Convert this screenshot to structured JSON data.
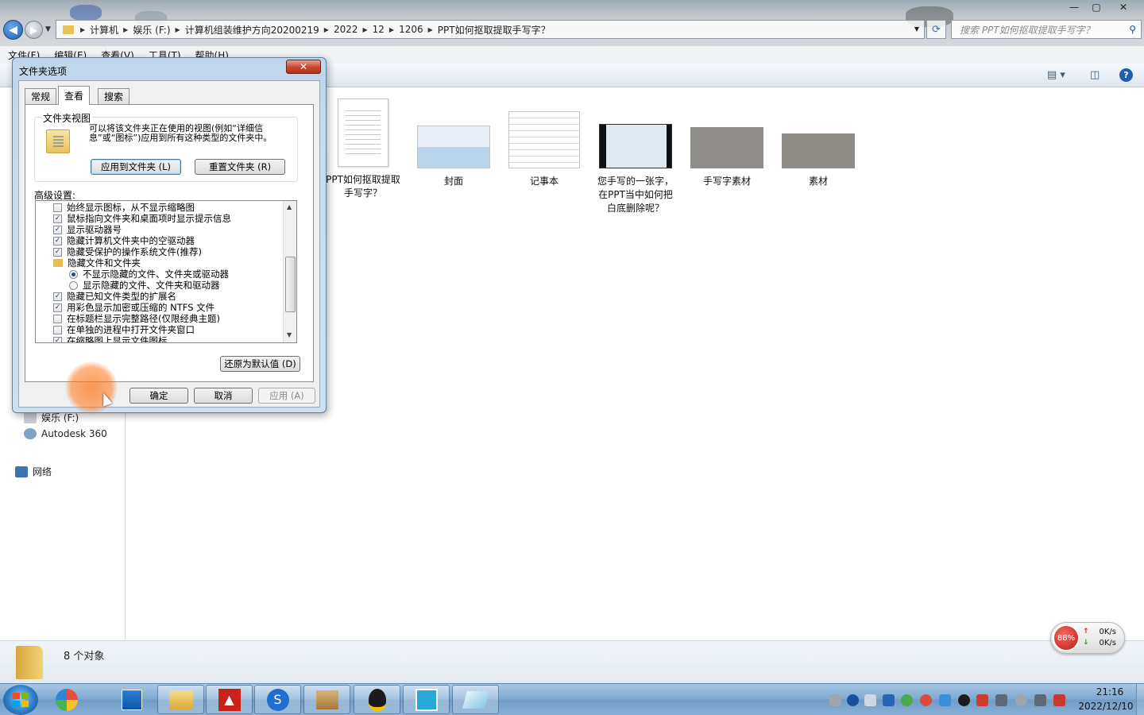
{
  "window": {
    "controls": [
      "—",
      "▢",
      "✕"
    ],
    "breadcrumb": [
      "计算机",
      "娱乐 (F:)",
      "计算机组装维护方向20200219",
      "2022",
      "12",
      "1206",
      "PPT如何抠取提取手写字？"
    ],
    "search_placeholder": "搜索 PPT如何抠取提取手写字？"
  },
  "menu": [
    "文件(F)",
    "编辑(E)",
    "查看(V)",
    "工具(T)",
    "帮助(H)"
  ],
  "nav_pane": {
    "items": [
      {
        "label": "娱乐 (F:)",
        "icon": "drive-icon"
      },
      {
        "label": "Autodesk 360",
        "icon": "autodesk-icon"
      },
      {
        "label": "网络",
        "icon": "network-icon"
      }
    ]
  },
  "files": [
    {
      "name": "PPT如何抠取提取手写字？",
      "type": "document"
    },
    {
      "name": "封面",
      "type": "image"
    },
    {
      "name": "记事本",
      "type": "notepad"
    },
    {
      "name": "您手写的一张字，在PPT当中如何把白底删除呢？",
      "type": "video"
    },
    {
      "name": "手写字素材",
      "type": "image"
    },
    {
      "name": "素材",
      "type": "image"
    }
  ],
  "status": {
    "count": "8 个对象"
  },
  "net_widget": {
    "percent": "88%",
    "up": "0K/s",
    "down": "0K/s"
  },
  "clock": {
    "time": "21:16",
    "date": "2022/12/10"
  },
  "dialog": {
    "title": "文件夹选项",
    "close": "✕",
    "tabs": [
      "常规",
      "查看",
      "搜索"
    ],
    "active_tab": "查看",
    "folder_view": {
      "legend": "文件夹视图",
      "description": "可以将该文件夹正在使用的视图(例如“详细信息”或“图标”)应用到所有这种类型的文件夹中。",
      "apply_button": "应用到文件夹 (L)",
      "reset_button": "重置文件夹 (R)"
    },
    "advanced_label": "高级设置:",
    "advanced_items": [
      {
        "label": "始终显示图标，从不显示缩略图",
        "kind": "checkbox",
        "checked": false
      },
      {
        "label": "鼠标指向文件夹和桌面项时显示提示信息",
        "kind": "checkbox",
        "checked": true
      },
      {
        "label": "显示驱动器号",
        "kind": "checkbox",
        "checked": true
      },
      {
        "label": "隐藏计算机文件夹中的空驱动器",
        "kind": "checkbox",
        "checked": true
      },
      {
        "label": "隐藏受保护的操作系统文件(推荐)",
        "kind": "checkbox",
        "checked": true
      },
      {
        "label": "隐藏文件和文件夹",
        "kind": "folder",
        "checked": false
      },
      {
        "label": "不显示隐藏的文件、文件夹或驱动器",
        "kind": "radio",
        "checked": true
      },
      {
        "label": "显示隐藏的文件、文件夹和驱动器",
        "kind": "radio",
        "checked": false
      },
      {
        "label": "隐藏已知文件类型的扩展名",
        "kind": "checkbox",
        "checked": true
      },
      {
        "label": "用彩色显示加密或压缩的 NTFS 文件",
        "kind": "checkbox",
        "checked": true
      },
      {
        "label": "在标题栏显示完整路径(仅限经典主题)",
        "kind": "checkbox",
        "checked": false
      },
      {
        "label": "在单独的进程中打开文件夹窗口",
        "kind": "checkbox",
        "checked": false
      },
      {
        "label": "在缩略图上显示文件图标",
        "kind": "checkbox",
        "checked": true
      }
    ],
    "restore_button": "还原为默认值 (D)",
    "ok_button": "确定",
    "cancel_button": "取消",
    "apply_button": "应用 (A)"
  }
}
